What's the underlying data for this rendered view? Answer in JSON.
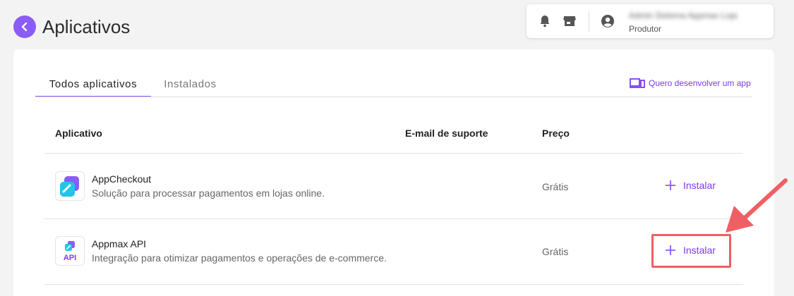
{
  "header": {
    "title": "Aplicativos",
    "user_name": "Admin Sistema Appmax Loja",
    "user_role": "Produtor"
  },
  "tabs": [
    {
      "label": "Todos aplicativos",
      "active": true
    },
    {
      "label": "Instalados",
      "active": false
    }
  ],
  "dev_link": "Quero desenvolver um app",
  "table": {
    "columns": [
      "Aplicativo",
      "E-mail de suporte",
      "Preço"
    ],
    "rows": [
      {
        "name": "AppCheckout",
        "description": "Solução para processar pagamentos em lojas online.",
        "support_email": "",
        "price": "Grátis",
        "action": "Instalar"
      },
      {
        "name": "Appmax API",
        "logo_text": "API",
        "description": "Integração para otimizar pagamentos e operações de e-commerce.",
        "support_email": "",
        "price": "Grátis",
        "action": "Instalar"
      }
    ]
  },
  "colors": {
    "accent": "#8b5cf6",
    "highlight": "#ef5f63"
  }
}
